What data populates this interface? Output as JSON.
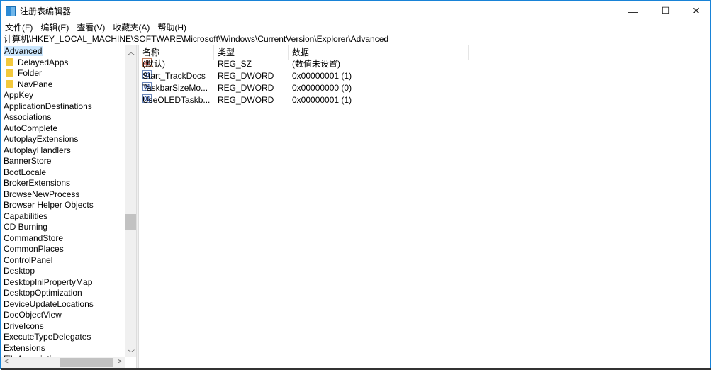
{
  "window": {
    "title": "注册表编辑器",
    "minimize": "—",
    "maximize": "☐",
    "close": "✕"
  },
  "menu": [
    "文件(F)",
    "编辑(E)",
    "查看(V)",
    "收藏夹(A)",
    "帮助(H)"
  ],
  "address": "计算机\\HKEY_LOCAL_MACHINE\\SOFTWARE\\Microsoft\\Windows\\CurrentVersion\\Explorer\\Advanced",
  "tree": {
    "selected": "Advanced",
    "children": [
      "DelayedApps",
      "Folder",
      "NavPane"
    ],
    "siblings": [
      "AppKey",
      "ApplicationDestinations",
      "Associations",
      "AutoComplete",
      "AutoplayExtensions",
      "AutoplayHandlers",
      "BannerStore",
      "BootLocale",
      "BrokerExtensions",
      "BrowseNewProcess",
      "Browser Helper Objects",
      "Capabilities",
      "CD Burning",
      "CommandStore",
      "CommonPlaces",
      "ControlPanel",
      "Desktop",
      "DesktopIniPropertyMap",
      "DesktopOptimization",
      "DeviceUpdateLocations",
      "DocObjectView",
      "DriveIcons",
      "ExecuteTypeDelegates",
      "Extensions",
      "FileAssociation"
    ]
  },
  "columns": {
    "name": "名称",
    "type": "类型",
    "data": "数据"
  },
  "values": [
    {
      "icon": "string-value-icon",
      "glyph": "ab",
      "name": "(默认)",
      "type": "REG_SZ",
      "data": "(数值未设置)"
    },
    {
      "icon": "binary-value-icon",
      "glyph": "01",
      "name": "Start_TrackDocs",
      "type": "REG_DWORD",
      "data": "0x00000001 (1)"
    },
    {
      "icon": "binary-value-icon",
      "glyph": "01",
      "name": "TaskbarSizeMo...",
      "type": "REG_DWORD",
      "data": "0x00000000 (0)"
    },
    {
      "icon": "binary-value-icon",
      "glyph": "01",
      "name": "UseOLEDTaskb...",
      "type": "REG_DWORD",
      "data": "0x00000001 (1)"
    }
  ]
}
